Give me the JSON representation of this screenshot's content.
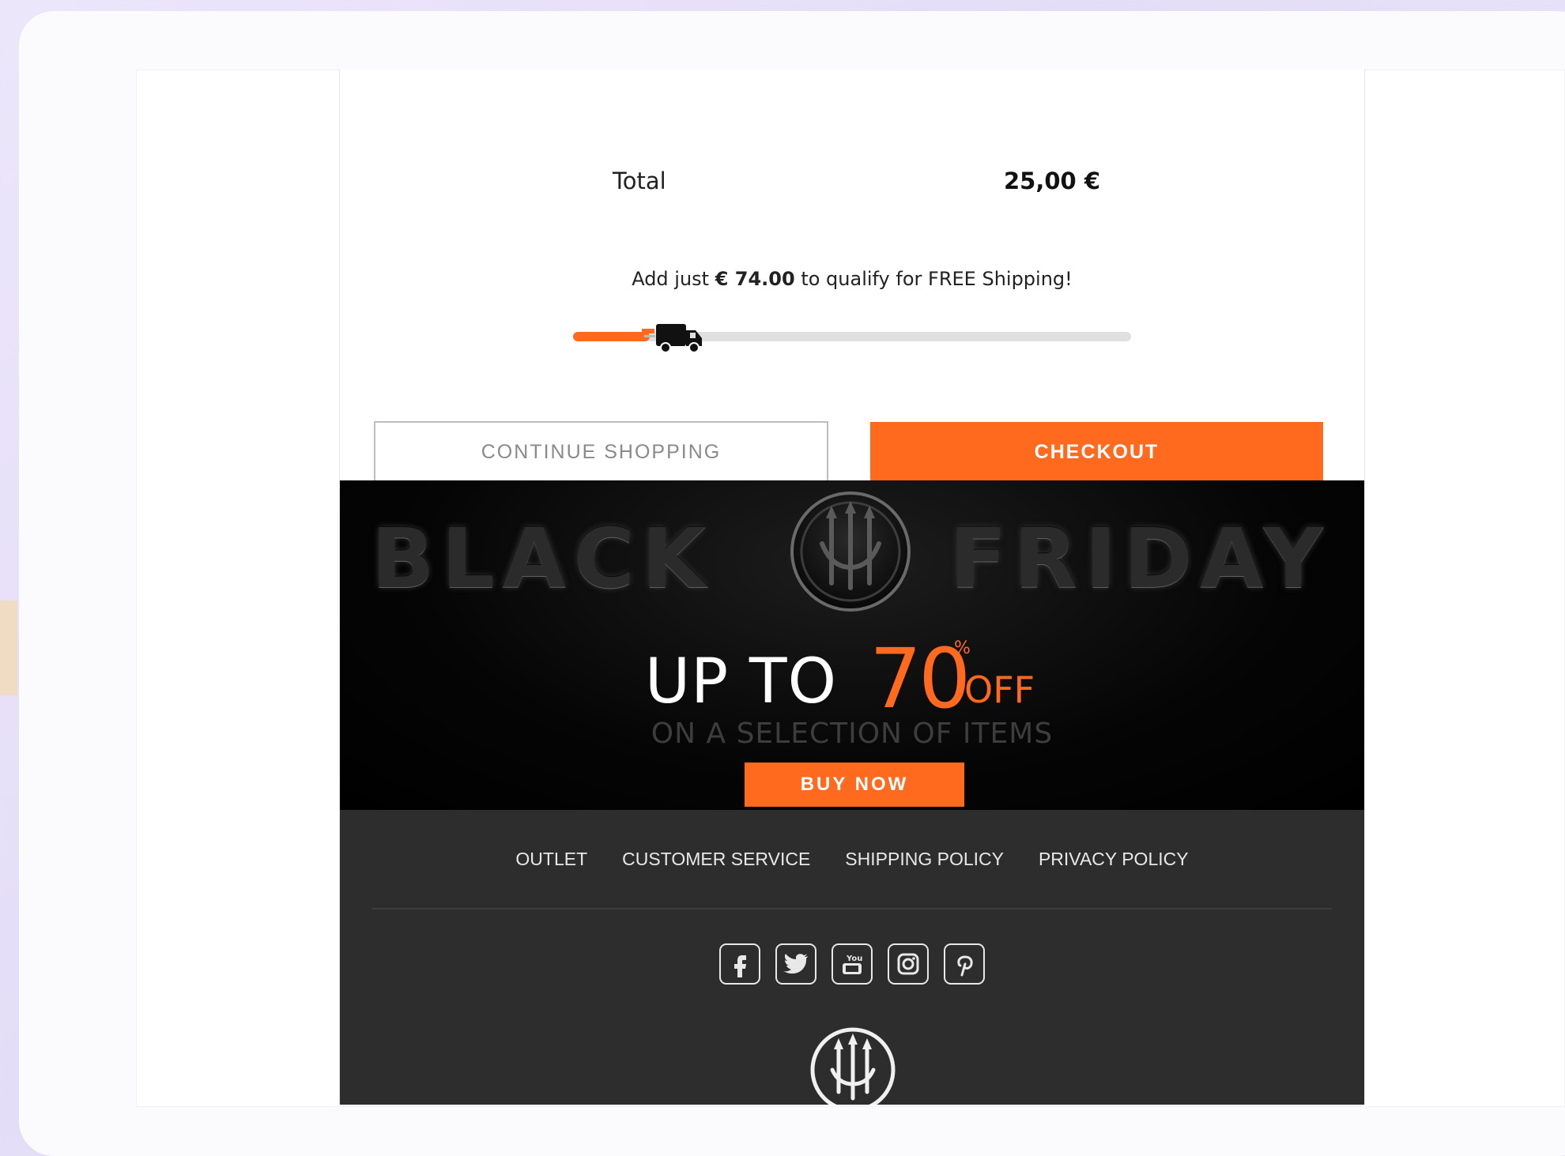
{
  "cart": {
    "total_label": "Total",
    "total_value": "25,00 €",
    "shipping_prefix": "Add just ",
    "shipping_amount": "€ 74.00",
    "shipping_suffix": " to qualify for FREE Shipping!",
    "shipping_progress": 0.25
  },
  "buttons": {
    "continue_label": "CONTINUE SHOPPING",
    "checkout_label": "CHECKOUT"
  },
  "banner": {
    "word_left": "BLACK",
    "word_right": "FRIDAY",
    "up_to": "UP TO",
    "percent": "70",
    "percent_sign": "%",
    "off": "OFF",
    "subline": "ON A SELECTION OF ITEMS",
    "buy_now": "BUY NOW"
  },
  "footer": {
    "links": [
      {
        "label": "OUTLET"
      },
      {
        "label": "CUSTOMER SERVICE"
      },
      {
        "label": "SHIPPING POLICY"
      },
      {
        "label": "PRIVACY POLICY"
      }
    ],
    "social": [
      "facebook-icon",
      "twitter-icon",
      "youtube-icon",
      "instagram-icon",
      "pinterest-icon"
    ]
  },
  "colors": {
    "accent": "#ff6a1f",
    "banner_bg": "#000000",
    "footer_bg": "#2d2d2d"
  }
}
